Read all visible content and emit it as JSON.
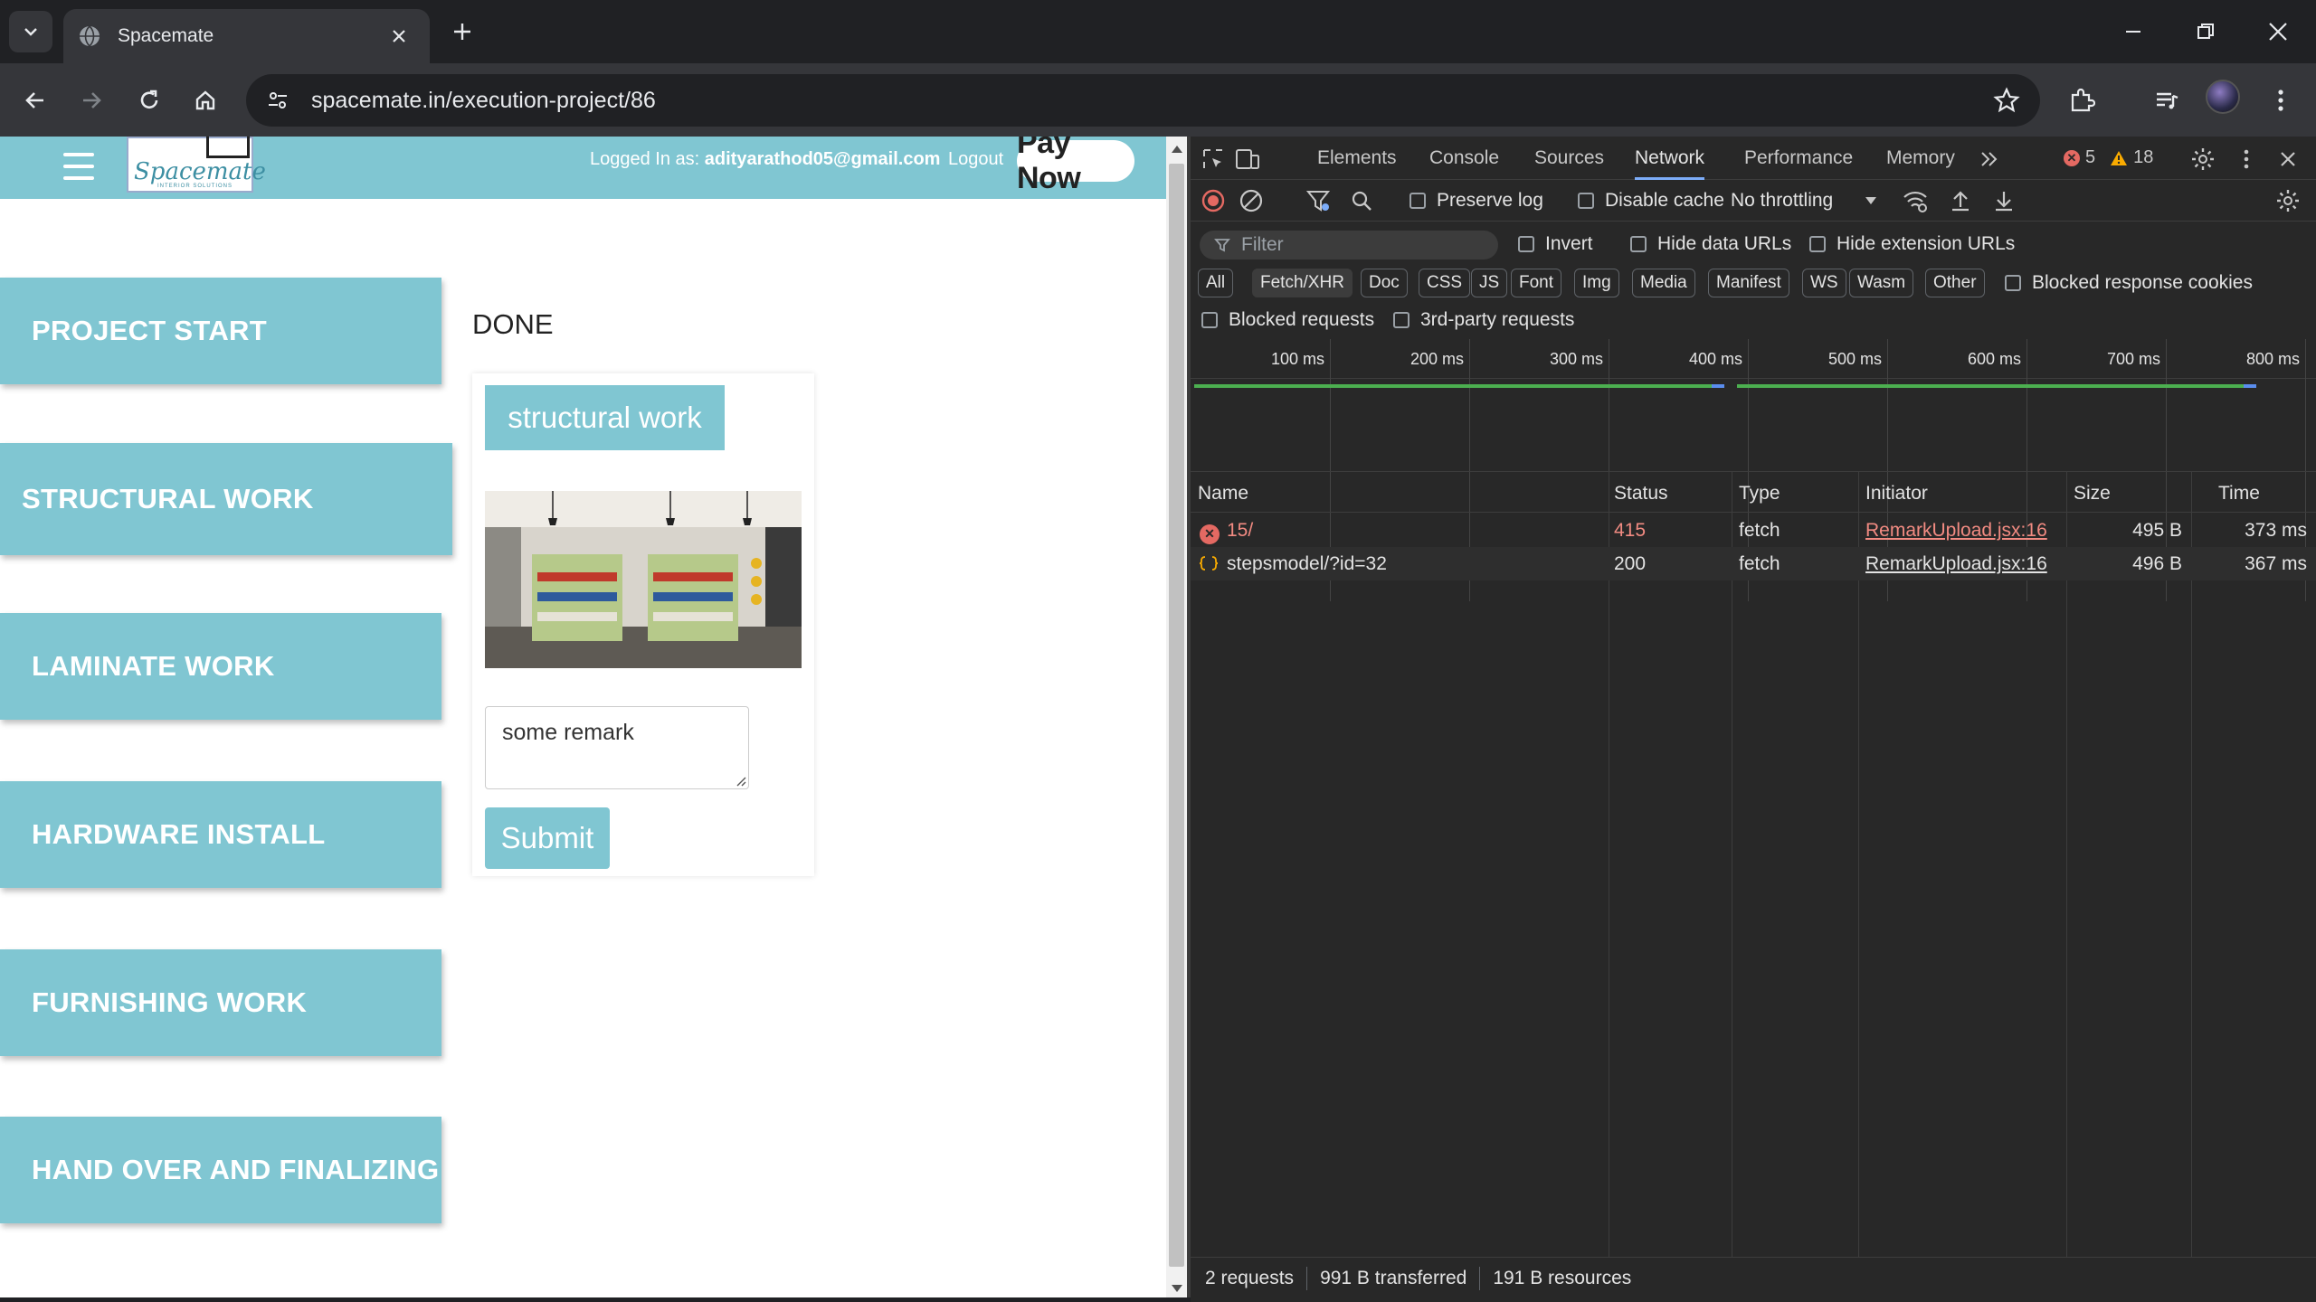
{
  "browser": {
    "tab_title": "Spacemate",
    "url": "spacemate.in/execution-project/86"
  },
  "site": {
    "logo_text": "Spacemate",
    "logo_sub": "INTERIOR SOLUTIONS",
    "logged_in_prefix": "Logged In as:",
    "logged_in_email": "adityarathod05@gmail.com",
    "logout": "Logout",
    "pay_now": "Pay Now"
  },
  "stages": [
    "PROJECT START",
    "STRUCTURAL WORK",
    "LAMINATE WORK",
    "HARDWARE INSTALL",
    "FURNISHING WORK",
    "HAND OVER AND FINALIZING"
  ],
  "detail": {
    "status": "DONE",
    "tag": "structural work",
    "remark": "some remark",
    "submit": "Submit"
  },
  "devtools": {
    "tabs": [
      "Elements",
      "Console",
      "Sources",
      "Network",
      "Performance",
      "Memory"
    ],
    "active_tab": "Network",
    "errors": "5",
    "warnings": "18",
    "preserve_log": "Preserve log",
    "disable_cache": "Disable cache",
    "throttling": "No throttling",
    "filter_placeholder": "Filter",
    "invert": "Invert",
    "hide_data_urls": "Hide data URLs",
    "hide_extension_urls": "Hide extension URLs",
    "type_chips": [
      "All",
      "Fetch/XHR",
      "Doc",
      "CSS",
      "JS",
      "Font",
      "Img",
      "Media",
      "Manifest",
      "WS",
      "Wasm",
      "Other"
    ],
    "active_chip": "Fetch/XHR",
    "blocked_response_cookies": "Blocked response cookies",
    "blocked_requests": "Blocked requests",
    "third_party_requests": "3rd-party requests",
    "timeline_ticks": [
      "100 ms",
      "200 ms",
      "300 ms",
      "400 ms",
      "500 ms",
      "600 ms",
      "700 ms",
      "800 ms"
    ],
    "columns": [
      "Name",
      "Status",
      "Type",
      "Initiator",
      "Size",
      "Time"
    ],
    "requests": [
      {
        "name": "15/",
        "status": "415",
        "type": "fetch",
        "initiator": "RemarkUpload.jsx:16",
        "size": "495 B",
        "time": "373 ms",
        "error": true
      },
      {
        "name": "stepsmodel/?id=32",
        "status": "200",
        "type": "fetch",
        "initiator": "RemarkUpload.jsx:16",
        "size": "496 B",
        "time": "367 ms",
        "error": false
      }
    ],
    "summary": {
      "requests": "2 requests",
      "transferred": "991 B transferred",
      "resources": "191 B resources"
    }
  },
  "colors": {
    "brand": "#80c6d2",
    "error": "#e46962",
    "devtools_bg": "#282828"
  }
}
